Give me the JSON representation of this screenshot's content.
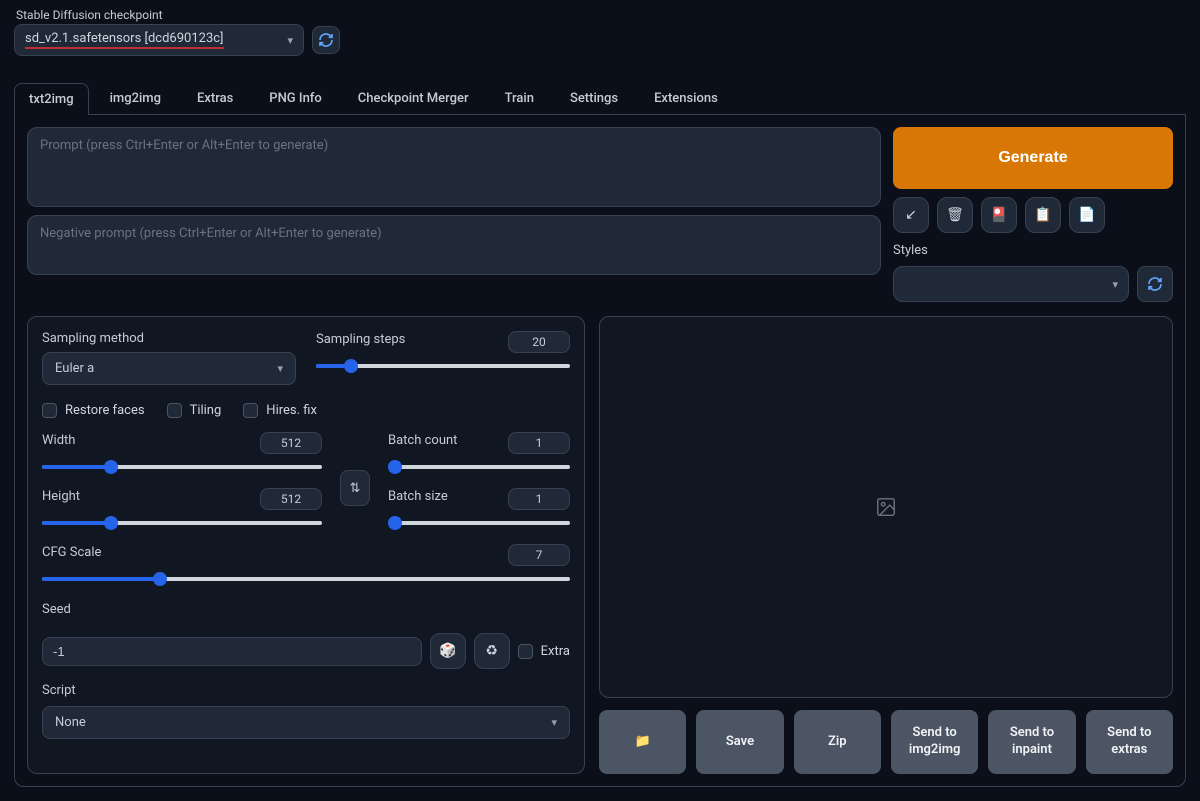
{
  "checkpoint": {
    "label": "Stable Diffusion checkpoint",
    "value": "sd_v2.1.safetensors [dcd690123c]"
  },
  "tabs": [
    "txt2img",
    "img2img",
    "Extras",
    "PNG Info",
    "Checkpoint Merger",
    "Train",
    "Settings",
    "Extensions"
  ],
  "active_tab": "txt2img",
  "prompt_placeholder": "Prompt (press Ctrl+Enter or Alt+Enter to generate)",
  "neg_prompt_placeholder": "Negative prompt (press Ctrl+Enter or Alt+Enter to generate)",
  "generate_label": "Generate",
  "styles_label": "Styles",
  "sampling": {
    "method_label": "Sampling method",
    "method_value": "Euler a",
    "steps_label": "Sampling steps",
    "steps_value": "20"
  },
  "checkboxes": {
    "restore_faces": "Restore faces",
    "tiling": "Tiling",
    "hires_fix": "Hires. fix"
  },
  "dims": {
    "width_label": "Width",
    "width_value": "512",
    "height_label": "Height",
    "height_value": "512"
  },
  "batch": {
    "count_label": "Batch count",
    "count_value": "1",
    "size_label": "Batch size",
    "size_value": "1"
  },
  "cfg": {
    "label": "CFG Scale",
    "value": "7"
  },
  "seed": {
    "label": "Seed",
    "value": "-1",
    "extra_label": "Extra"
  },
  "script": {
    "label": "Script",
    "value": "None"
  },
  "actions": {
    "folder": "📁",
    "save": "Save",
    "zip": "Zip",
    "send_img2img": "Send to img2img",
    "send_inpaint": "Send to inpaint",
    "send_extras": "Send to extras"
  }
}
